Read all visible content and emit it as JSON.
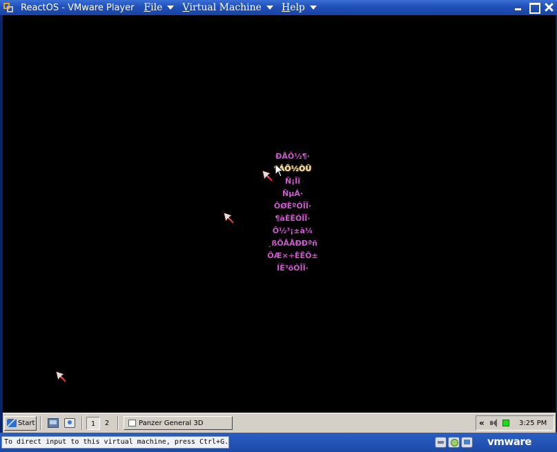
{
  "window": {
    "title": "ReactOS - VMware Player",
    "menus": [
      {
        "accel": "F",
        "rest": "ile"
      },
      {
        "accel": "V",
        "rest": "irtual Machine"
      },
      {
        "accel": "H",
        "rest": "elp"
      }
    ]
  },
  "game_menu": {
    "items": [
      "ÐÂÕ½¶·",
      "¶ÁÕ½ÒÛ",
      "Ñ¡Ïî",
      "ÑµÁ·",
      "ÕØÈºÓÎÏ·",
      "¶àÈËÓÎÏ·",
      "Õ½³¡±à¼­",
      "¸ßÕÂÅÐÐªñ",
      "ÕÆ×÷ÈËÔ±",
      "ÍË³öÓÎÏ·"
    ],
    "selected_index": 1
  },
  "taskbar": {
    "start_label": "Start",
    "virtual_desktops": [
      "1",
      "2"
    ],
    "active_desktop": "1",
    "task_label": "Panzer General 3D",
    "tray_chevron": "«",
    "clock": "3:25 PM"
  },
  "statusbar": {
    "hint": "To direct input to this virtual machine, press Ctrl+G.",
    "logo": "vmware"
  },
  "colors": {
    "menu_text": "#d05ad0",
    "menu_selected": "#ffe6a8",
    "titlebar": "#1f4fb8"
  }
}
